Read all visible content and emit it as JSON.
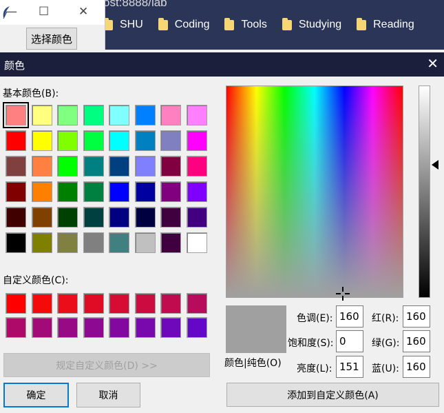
{
  "browser": {
    "url_fragment": "ost:8888/lab",
    "bookmarks": [
      {
        "label": "SHU"
      },
      {
        "label": "Coding"
      },
      {
        "label": "Tools"
      },
      {
        "label": "Studying"
      },
      {
        "label": "Reading"
      }
    ]
  },
  "tk_window": {
    "minimize_glyph": "—",
    "maximize_glyph": "☐",
    "close_glyph": "✕",
    "choose_color_button": "选择颜色"
  },
  "dialog": {
    "title": "颜色",
    "close_glyph": "✕",
    "basic_colors_label": "基本颜色(B):",
    "basic_colors": [
      [
        "#ff8080",
        "#ffff80",
        "#80ff80",
        "#00ff80",
        "#80ffff",
        "#0080ff",
        "#ff80c0",
        "#ff80ff"
      ],
      [
        "#ff0000",
        "#ffff00",
        "#80ff00",
        "#00ff40",
        "#00ffff",
        "#0080c0",
        "#8080c0",
        "#ff00ff"
      ],
      [
        "#804040",
        "#ff8040",
        "#00ff00",
        "#008080",
        "#004080",
        "#8080ff",
        "#800040",
        "#ff0080"
      ],
      [
        "#800000",
        "#ff8000",
        "#008000",
        "#008040",
        "#0000ff",
        "#0000a0",
        "#800080",
        "#8000ff"
      ],
      [
        "#400000",
        "#804000",
        "#004000",
        "#004040",
        "#000080",
        "#000040",
        "#400040",
        "#400080"
      ],
      [
        "#000000",
        "#808000",
        "#808040",
        "#808080",
        "#408080",
        "#c0c0c0",
        "#400040",
        "#ffffff"
      ]
    ],
    "custom_colors_label": "自定义颜色(C):",
    "custom_colors": [
      [
        "#ff0000",
        "#f50a0a",
        "#eb0d19",
        "#e00c26",
        "#d60c34",
        "#cc0c41",
        "#c10b4f",
        "#b70b5c"
      ],
      [
        "#ad0a6a",
        "#a20a77",
        "#980985",
        "#8e0992",
        "#83089f",
        "#7908ad",
        "#6f08ba",
        "#6407c8"
      ]
    ],
    "define_custom_button": "规定自定义颜色(D) >>",
    "ok_button": "确定",
    "cancel_button": "取消",
    "color_solid_label": "颜色|纯色(O)",
    "preview_color": "#a0a0a0",
    "hue_label": "色调(E):",
    "hue_value": "160",
    "sat_label": "饱和度(S):",
    "sat_value": "0",
    "lum_label": "亮度(L):",
    "lum_value": "151",
    "red_label": "红(R):",
    "red_value": "160",
    "green_label": "绿(G):",
    "green_value": "160",
    "blue_label": "蓝(U):",
    "blue_value": "160",
    "add_custom_button": "添加到自定义颜色(A)"
  }
}
